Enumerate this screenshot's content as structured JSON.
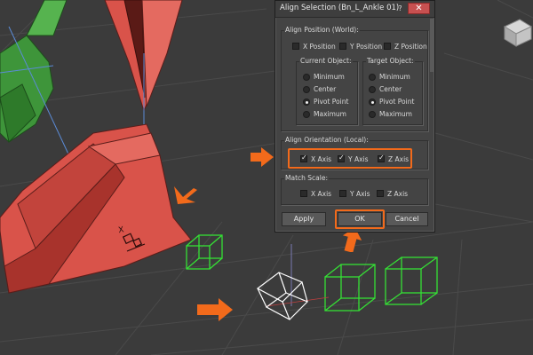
{
  "dialog": {
    "title": "Align Selection (Bn_L_Ankle 01)",
    "help_label": "?",
    "close_label": "✕",
    "align_position": {
      "label": "Align Position (World):",
      "x": {
        "label": "X Position",
        "checked": false
      },
      "y": {
        "label": "Y Position",
        "checked": false
      },
      "z": {
        "label": "Z Position",
        "checked": false
      }
    },
    "current_object": {
      "label": "Current Object:",
      "options": [
        "Minimum",
        "Center",
        "Pivot Point",
        "Maximum"
      ],
      "selected": "Pivot Point"
    },
    "target_object": {
      "label": "Target Object:",
      "options": [
        "Minimum",
        "Center",
        "Pivot Point",
        "Maximum"
      ],
      "selected": "Pivot Point"
    },
    "align_orientation": {
      "label": "Align Orientation (Local):",
      "x": {
        "label": "X Axis",
        "checked": true
      },
      "y": {
        "label": "Y Axis",
        "checked": true
      },
      "z": {
        "label": "Z Axis",
        "checked": true
      }
    },
    "match_scale": {
      "label": "Match Scale:",
      "x": {
        "label": "X Axis",
        "checked": false
      },
      "y": {
        "label": "Y Axis",
        "checked": false
      },
      "z": {
        "label": "Z Axis",
        "checked": false
      }
    },
    "buttons": {
      "apply": "Apply",
      "ok": "OK",
      "cancel": "Cancel"
    }
  },
  "viewport": {
    "foot_label": "X",
    "colors": {
      "background": "#3b3b3b",
      "red_object": "#d9534a",
      "green_object": "#3f9a3a",
      "box_green": "#35e035",
      "annotation_orange": "#f26a1b",
      "wire_white": "#ffffff"
    }
  }
}
